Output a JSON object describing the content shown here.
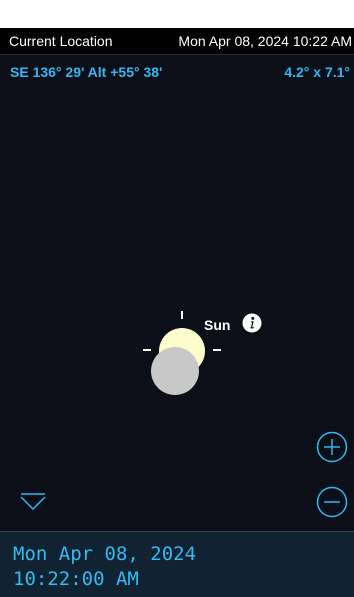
{
  "header": {
    "location": "Current Location",
    "datetime": "Mon Apr 08, 2024  10:22 AM"
  },
  "view": {
    "coordinates": "SE 136° 29' Alt +55° 38'",
    "field_of_view": "4.2° x 7.1°",
    "object_label": "Sun"
  },
  "icons": {
    "info": "info-icon",
    "zoom_in": "zoom-in-icon",
    "zoom_out": "zoom-out-icon",
    "collapse": "chevron-down-icon"
  },
  "footer": {
    "date": "Mon Apr 08, 2024",
    "time": "10:22:00 AM"
  },
  "colors": {
    "accent": "#2fb8f2",
    "sky": "#0d0f18",
    "sun": "#fdfccc",
    "moon": "#c8c8c8",
    "footer_bg": "#112233"
  }
}
